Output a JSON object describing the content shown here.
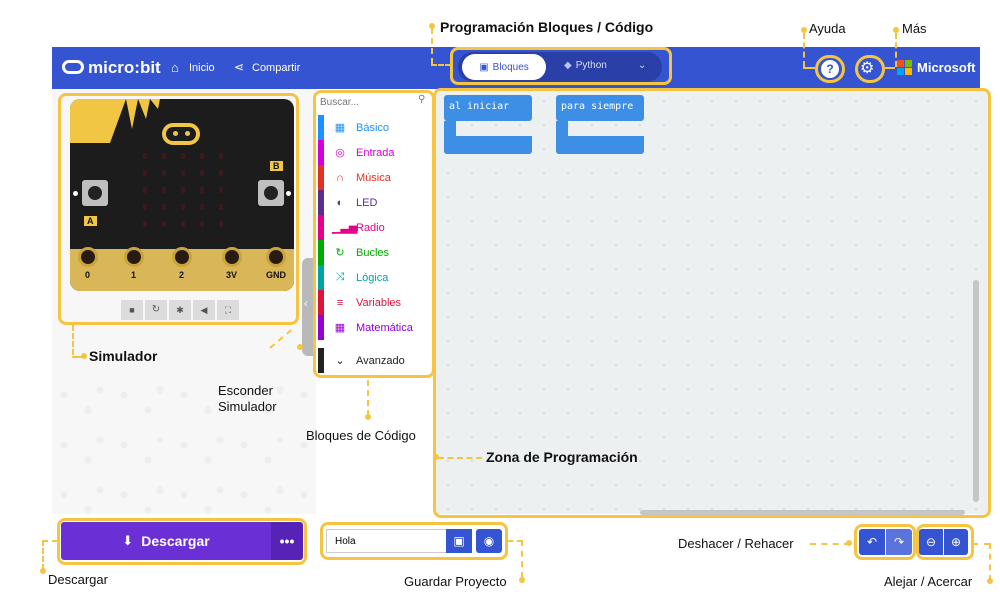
{
  "header": {
    "logo": "micro:bit",
    "home": "Inicio",
    "share": "Compartir",
    "tab_blocks": "Bloques",
    "tab_python": "Python",
    "brand": "Microsoft"
  },
  "annotations": {
    "prog_mode": "Programación Bloques / Código",
    "help": "Ayuda",
    "more": "Más",
    "simulator": "Simulador",
    "hide_sim": "Esconder\nSimulador",
    "code_blocks": "Bloques de Código",
    "workspace": "Zona de Programación",
    "download": "Descargar",
    "save": "Guardar Proyecto",
    "undo_redo": "Deshacer / Rehacer",
    "zoom": "Alejar / Acercar"
  },
  "toolbox": {
    "search_placeholder": "Buscar...",
    "categories": [
      {
        "label": "Básico",
        "color": "#1e90ff"
      },
      {
        "label": "Entrada",
        "color": "#d400d4"
      },
      {
        "label": "Música",
        "color": "#e63022"
      },
      {
        "label": "LED",
        "color": "#5c2d91"
      },
      {
        "label": "Radio",
        "color": "#e3008c"
      },
      {
        "label": "Bucles",
        "color": "#00aa00"
      },
      {
        "label": "Lógica",
        "color": "#00a4a6"
      },
      {
        "label": "Variables",
        "color": "#dc143c"
      },
      {
        "label": "Matemática",
        "color": "#9400d3"
      }
    ],
    "advanced": "Avanzado"
  },
  "workspace": {
    "block_start": "al iniciar",
    "block_forever": "para siempre"
  },
  "simulator": {
    "pins": [
      "0",
      "1",
      "2",
      "3V",
      "GND"
    ],
    "button_a": "A",
    "button_b": "B"
  },
  "footer": {
    "download_label": "Descargar",
    "project_name": "Hola"
  },
  "colors": {
    "header": "#3454d1",
    "highlight": "#f5c542",
    "download": "#6b2fd6",
    "block": "#3d8fe6"
  },
  "icons": [
    "microbit-logo-icon",
    "home-icon",
    "share-icon",
    "blocks-icon",
    "python-icon",
    "chevron-down-icon",
    "help-icon",
    "gear-icon",
    "microsoft-logo-icon",
    "search-icon",
    "download-icon",
    "more-icon",
    "save-icon",
    "github-icon",
    "undo-icon",
    "redo-icon",
    "zoom-out-icon",
    "zoom-in-icon",
    "collapse-icon"
  ]
}
